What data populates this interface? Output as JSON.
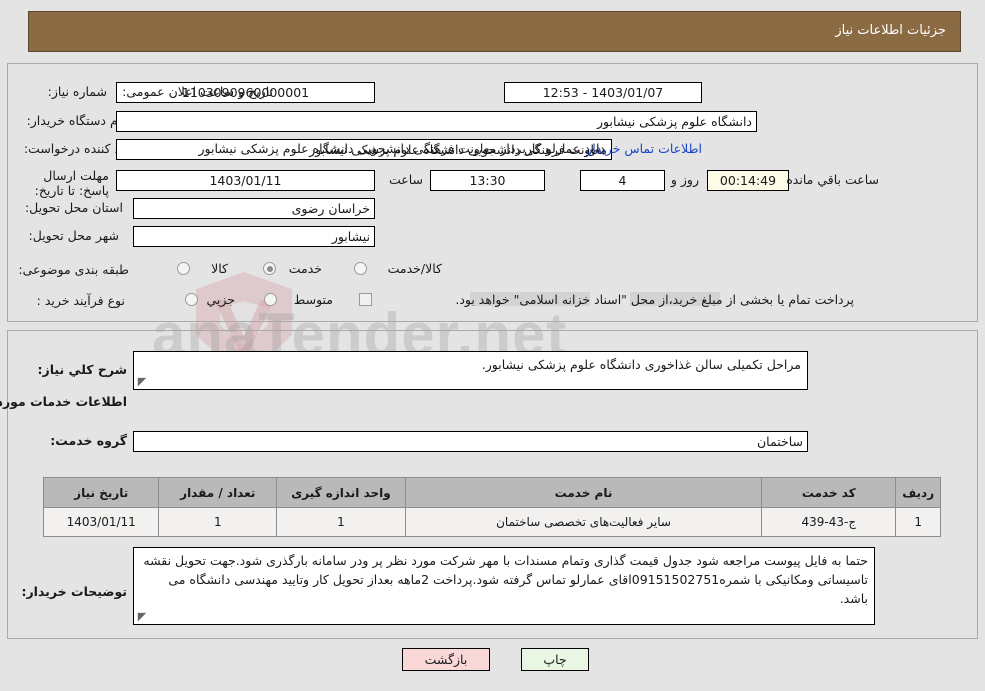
{
  "header": {
    "title": "جزئیات اطلاعات نیاز"
  },
  "watermark": {
    "text": "anaTender.net"
  },
  "form": {
    "need_number": {
      "label": "شماره نیاز:",
      "value": "1103090960000001"
    },
    "announce_datetime": {
      "label": "تاریخ و ساعت اعلان عمومی:",
      "value": "1403/01/07 - 12:53"
    },
    "buyer_org": {
      "label": "نام دستگاه خریدار:",
      "value": "دانشگاه علوم پزشکی نیشابور"
    },
    "requester": {
      "label": "ایجاد کننده درخواست:",
      "value": "معاونت فرهنگی دانشجویی دانشگاه علوم پزشکی نیشابور"
    },
    "requester_extra": "داود عمارلو کاربرداز معاونت فرهنگی دانشجویی دانشگاه علوم پزشکی نیشابور",
    "buyer_contact_link": "اطلاعات تماس خریدار",
    "deadline": {
      "label": "مهلت ارسال پاسخ: تا تاریخ:",
      "date": "1403/01/11",
      "time_label": "ساعت",
      "time": "13:30",
      "days": "4",
      "days_label": "روز و",
      "countdown": "00:14:49",
      "countdown_label": "ساعت باقي مانده"
    },
    "province": {
      "label": "استان محل تحویل:",
      "value": "خراسان رضوی"
    },
    "city": {
      "label": "شهر محل تحویل:",
      "value": "نیشابور"
    },
    "category": {
      "label": "طبقه بندی موضوعی:",
      "options": [
        {
          "label": "کالا",
          "selected": false
        },
        {
          "label": "خدمت",
          "selected": true
        },
        {
          "label": "کالا/خدمت",
          "selected": false
        }
      ]
    },
    "process_type": {
      "label": "نوع فرآیند خرید :",
      "options": [
        {
          "label": "جزیي",
          "selected": false
        },
        {
          "label": "متوسط",
          "selected": false
        }
      ],
      "note": "پرداخت تمام یا بخشی از مبلغ خرید،از محل \"اسناد خزانه اسلامی\" خواهد بود.",
      "note_checked": false
    }
  },
  "detail": {
    "general_desc": {
      "label": "شرح کلي نیاز:",
      "value": "مراحل تکمیلی سالن غذاخوری دانشگاه علوم پزشکی نیشابور."
    },
    "services_heading": "اطلاعات خدمات مورد نیاز",
    "service_group": {
      "label": "گروه خدمت:",
      "value": "ساختمان"
    },
    "table": {
      "headers": [
        "ردیف",
        "کد خدمت",
        "نام خدمت",
        "واحد اندازه گیری",
        "تعداد / مقدار",
        "تاریخ نیاز"
      ],
      "rows": [
        [
          "1",
          "ج-43-439",
          "سایر فعالیت‌های تخصصی ساختمان",
          "1",
          "1",
          "1403/01/11"
        ]
      ]
    },
    "buyer_notes": {
      "label": "توضیحات خریدار:",
      "value": "حتما به فایل پیوست مراجعه شود جدول قیمت گذاری وتمام مسندات با مهر شرکت مورد نظر پر ودر سامانه بارگذری شود.جهت تحویل نقشه تاسیساتی ومکانیکی با شمره09151502751اقای عمارلو تماس گرفته شود.پرداخت 2ماهه بعداز تحویل کار وتایید مهندسی دانشگاه می باشد."
    }
  },
  "footer": {
    "print_label": "چاپ",
    "back_label": "بازگشت"
  },
  "colors": {
    "header_bg": "#8b6b44",
    "header_text": "#ffffff",
    "link": "#1a44c8",
    "timer_bg": "#fbfbe8",
    "print_bg": "#e9f6e4",
    "back_bg": "#fbd8d8",
    "table_header_bg": "#b9b9b9",
    "page_bg": "#e4e4e4"
  }
}
